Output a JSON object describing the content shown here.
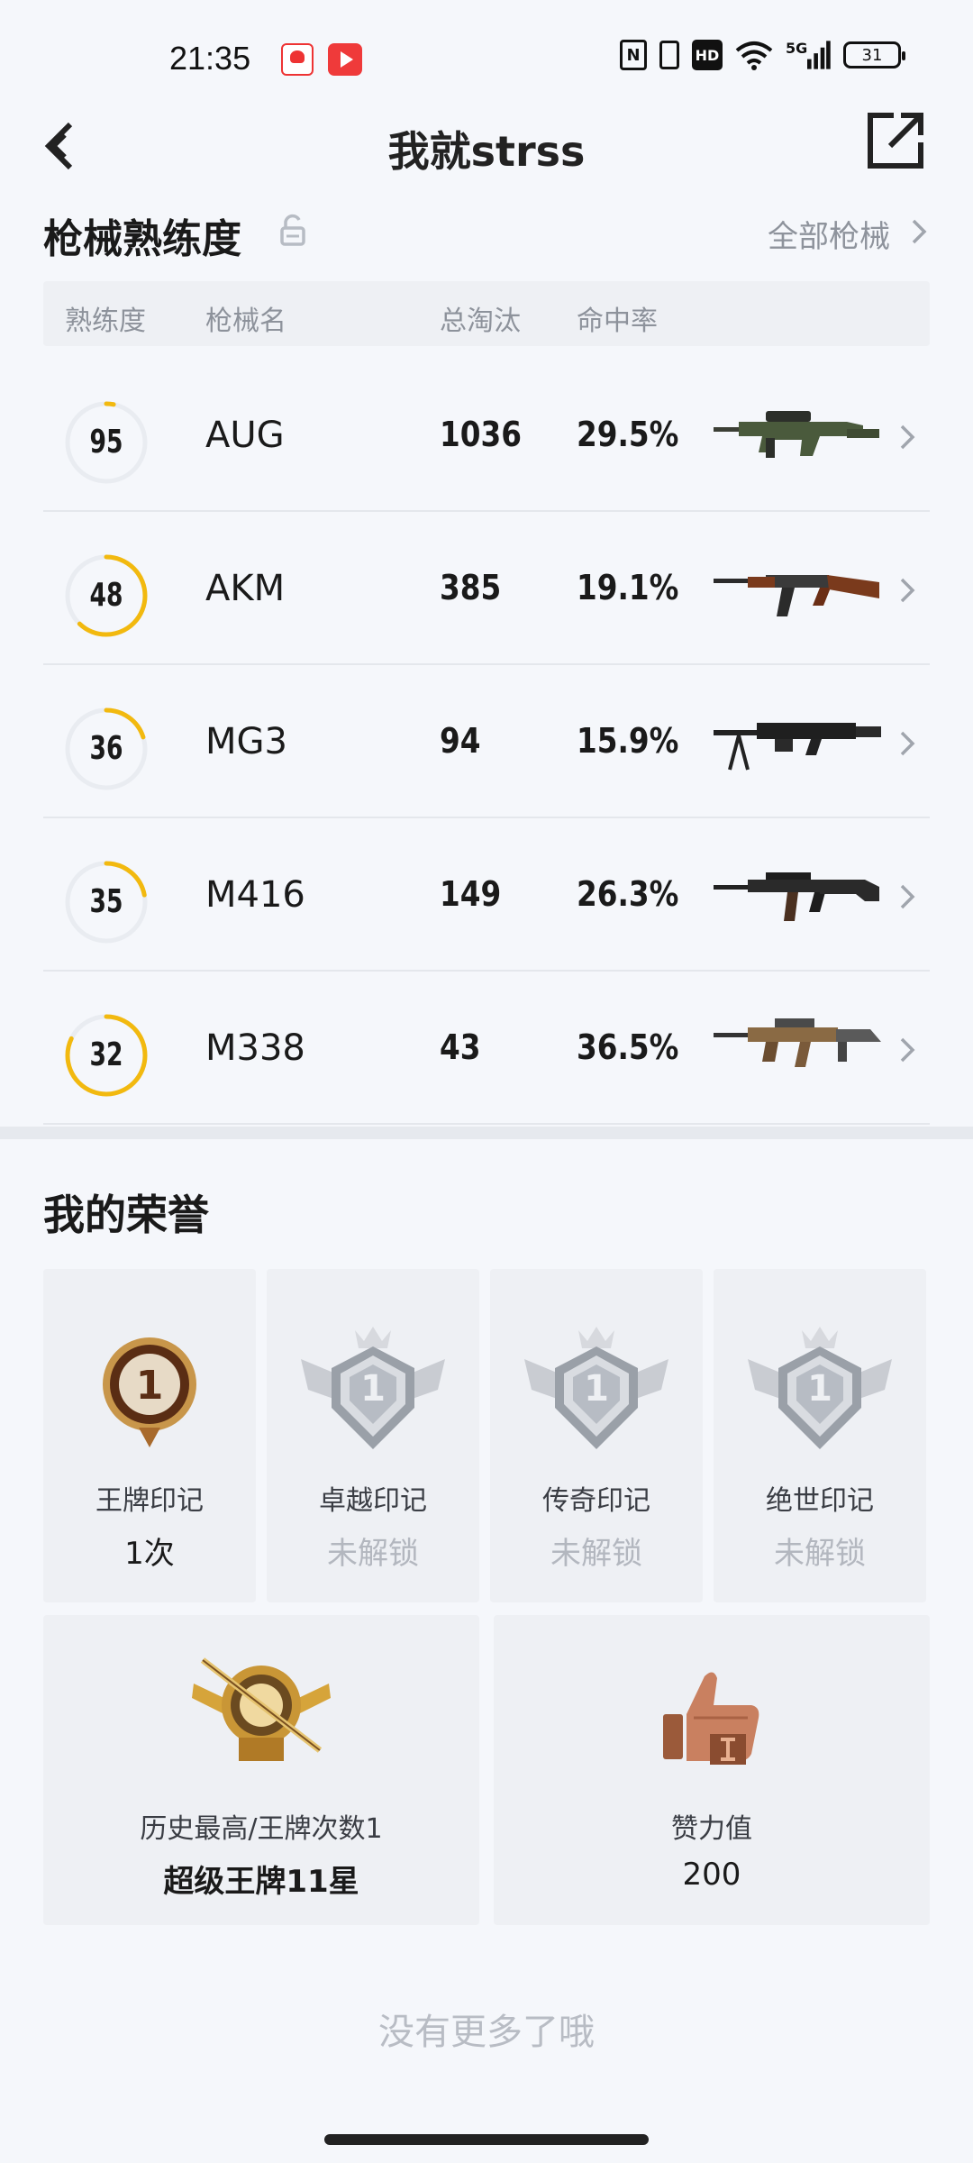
{
  "status_bar": {
    "time": "21:35",
    "hd": "HD",
    "network": "5G",
    "battery": "31",
    "icons": [
      "game-app-icon",
      "video-app-icon",
      "nfc-icon",
      "vibrate-icon",
      "hd-icon",
      "wifi-icon",
      "signal-icon",
      "battery-icon"
    ]
  },
  "header": {
    "title": "我就strss",
    "back_icon": "back-arrow-icon",
    "share_icon": "share-icon"
  },
  "weapons": {
    "section_title": "枪械熟练度",
    "all_link": "全部枪械",
    "columns": [
      "熟练度",
      "枪械名",
      "总淘汰",
      "命中率"
    ],
    "rows": [
      {
        "proficiency": "95",
        "name": "AUG",
        "kills": "1036",
        "hit_rate": "29.5%",
        "ring_fill": 0.03
      },
      {
        "proficiency": "48",
        "name": "AKM",
        "kills": "385",
        "hit_rate": "19.1%",
        "ring_fill": 0.62
      },
      {
        "proficiency": "36",
        "name": "MG3",
        "kills": "94",
        "hit_rate": "15.9%",
        "ring_fill": 0.2
      },
      {
        "proficiency": "35",
        "name": "M416",
        "kills": "149",
        "hit_rate": "26.3%",
        "ring_fill": 0.22
      },
      {
        "proficiency": "32",
        "name": "M338",
        "kills": "43",
        "hit_rate": "36.5%",
        "ring_fill": 0.82
      }
    ],
    "ring_color": "#f2b90f"
  },
  "honors": {
    "section_title": "我的荣誉",
    "badges": [
      {
        "label": "王牌印记",
        "value": "1次",
        "locked": false
      },
      {
        "label": "卓越印记",
        "value": "未解锁",
        "locked": true
      },
      {
        "label": "传奇印记",
        "value": "未解锁",
        "locked": true
      },
      {
        "label": "绝世印记",
        "value": "未解锁",
        "locked": true
      }
    ],
    "big_cards": [
      {
        "label": "历史最高/王牌次数1",
        "value": "超级王牌11星"
      },
      {
        "label": "赞力值",
        "value": "200"
      }
    ],
    "badge_number": "1"
  },
  "footer": {
    "no_more": "没有更多了哦"
  }
}
